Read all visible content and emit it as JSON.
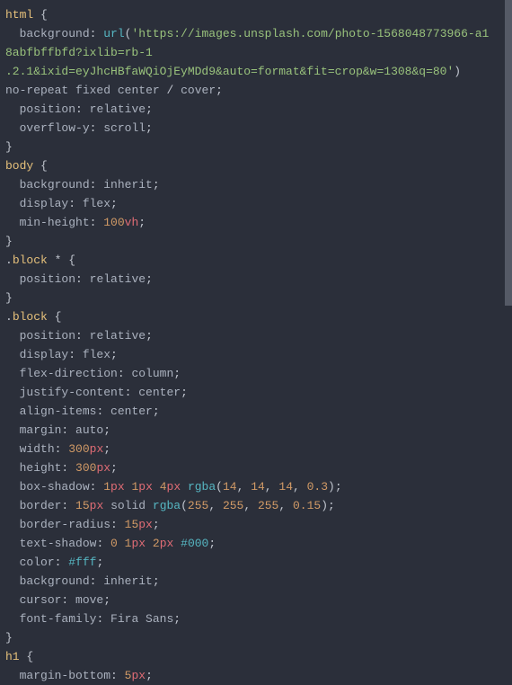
{
  "code": {
    "rules": [
      {
        "selector": "html",
        "declarations": [
          {
            "property": "background",
            "value_type": "url_shorthand",
            "url": "https://images.unsplash.com/photo-1568048773966-a18abfbffbfd?ixlib=rb-1.2.1&ixid=eyJhcHBfaWQiOjEyMDd9&auto=format&fit=crop&w=1308&q=80",
            "tail": [
              "no-repeat",
              "fixed",
              "center",
              "/",
              "cover"
            ]
          },
          {
            "property": "position",
            "value_type": "ident",
            "value": "relative"
          },
          {
            "property": "overflow-y",
            "value_type": "ident",
            "value": "scroll"
          }
        ]
      },
      {
        "selector": "body",
        "declarations": [
          {
            "property": "background",
            "value_type": "ident",
            "value": "inherit"
          },
          {
            "property": "display",
            "value_type": "ident",
            "value": "flex"
          },
          {
            "property": "min-height",
            "value_type": "length",
            "number": "100",
            "unit": "vh"
          }
        ]
      },
      {
        "selector": ".block *",
        "declarations": [
          {
            "property": "position",
            "value_type": "ident",
            "value": "relative"
          }
        ]
      },
      {
        "selector": ".block",
        "declarations": [
          {
            "property": "position",
            "value_type": "ident",
            "value": "relative"
          },
          {
            "property": "display",
            "value_type": "ident",
            "value": "flex"
          },
          {
            "property": "flex-direction",
            "value_type": "ident",
            "value": "column"
          },
          {
            "property": "justify-content",
            "value_type": "ident",
            "value": "center"
          },
          {
            "property": "align-items",
            "value_type": "ident",
            "value": "center"
          },
          {
            "property": "margin",
            "value_type": "ident",
            "value": "auto"
          },
          {
            "property": "width",
            "value_type": "length",
            "number": "300",
            "unit": "px"
          },
          {
            "property": "height",
            "value_type": "length",
            "number": "300",
            "unit": "px"
          },
          {
            "property": "box-shadow",
            "value_type": "shadow",
            "lengths": [
              {
                "n": "1",
                "u": "px"
              },
              {
                "n": "1",
                "u": "px"
              },
              {
                "n": "4",
                "u": "px"
              }
            ],
            "rgba": [
              "14",
              "14",
              "14",
              "0.3"
            ]
          },
          {
            "property": "border",
            "value_type": "border",
            "length": {
              "n": "15",
              "u": "px"
            },
            "style": "solid",
            "rgba": [
              "255",
              "255",
              "255",
              "0.15"
            ]
          },
          {
            "property": "border-radius",
            "value_type": "length",
            "number": "15",
            "unit": "px"
          },
          {
            "property": "text-shadow",
            "value_type": "textshadow",
            "lengths": [
              {
                "n": "0",
                "u": ""
              },
              {
                "n": "1",
                "u": "px"
              },
              {
                "n": "2",
                "u": "px"
              }
            ],
            "hex": "#000"
          },
          {
            "property": "color",
            "value_type": "hex",
            "value": "#fff"
          },
          {
            "property": "background",
            "value_type": "ident",
            "value": "inherit"
          },
          {
            "property": "cursor",
            "value_type": "ident",
            "value": "move"
          },
          {
            "property": "font-family",
            "value_type": "ident",
            "value": "Fira Sans"
          }
        ]
      },
      {
        "selector": "h1",
        "open_only": true,
        "declarations": [
          {
            "property": "margin-bottom",
            "value_type": "length",
            "number": "5",
            "unit": "px"
          }
        ]
      }
    ]
  }
}
